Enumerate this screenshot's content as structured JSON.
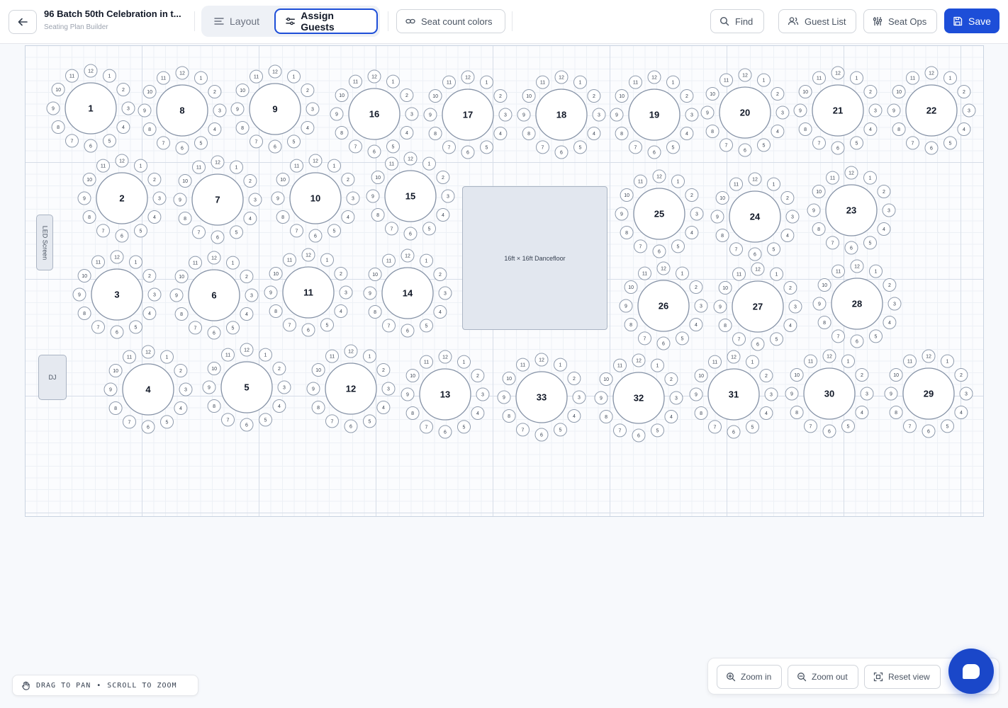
{
  "header": {
    "title": "96 Batch 50th Celebration in t...",
    "subtitle": "Seating Plan Builder",
    "layout_label": "Layout",
    "assign_label": "Assign Guests",
    "seat_colors_label": "Seat count colors",
    "find_label": "Find",
    "guest_list_label": "Guest List",
    "seat_ops_label": "Seat Ops",
    "save_label": "Save"
  },
  "floor": {
    "led_label": "LED Screen",
    "dj_label": "DJ",
    "dancefloor_label": "16ft × 16ft Dancefloor",
    "seats_per_table": 12,
    "tables": [
      {
        "num": "1"
      },
      {
        "num": "8"
      },
      {
        "num": "9"
      },
      {
        "num": "16"
      },
      {
        "num": "17"
      },
      {
        "num": "18"
      },
      {
        "num": "19"
      },
      {
        "num": "20"
      },
      {
        "num": "21"
      },
      {
        "num": "22"
      },
      {
        "num": "2"
      },
      {
        "num": "7"
      },
      {
        "num": "10"
      },
      {
        "num": "15"
      },
      {
        "num": "25"
      },
      {
        "num": "24"
      },
      {
        "num": "23"
      },
      {
        "num": "3"
      },
      {
        "num": "6"
      },
      {
        "num": "11"
      },
      {
        "num": "14"
      },
      {
        "num": "26"
      },
      {
        "num": "27"
      },
      {
        "num": "28"
      },
      {
        "num": "4"
      },
      {
        "num": "5"
      },
      {
        "num": "12"
      },
      {
        "num": "13"
      },
      {
        "num": "33"
      },
      {
        "num": "32"
      },
      {
        "num": "31"
      },
      {
        "num": "30"
      },
      {
        "num": "29"
      }
    ]
  },
  "footer": {
    "hint_pan": "DRAG TO PAN",
    "hint_sep": "•",
    "hint_zoom": "SCROLL TO ZOOM",
    "zoom_in_label": "Zoom in",
    "zoom_out_label": "Zoom out",
    "reset_view_label": "Reset view"
  },
  "colors": {
    "primary": "#1d4ed8",
    "table_stroke": "#8592a6",
    "seat_stroke": "#8f9bad"
  },
  "icons": [
    "back-arrow-icon",
    "layout-icon",
    "sliders-icon",
    "link-icon",
    "search-icon",
    "users-icon",
    "seat-ops-icon",
    "save-icon",
    "hand-icon",
    "zoom-in-icon",
    "zoom-out-icon",
    "reset-view-icon",
    "chat-icon"
  ]
}
